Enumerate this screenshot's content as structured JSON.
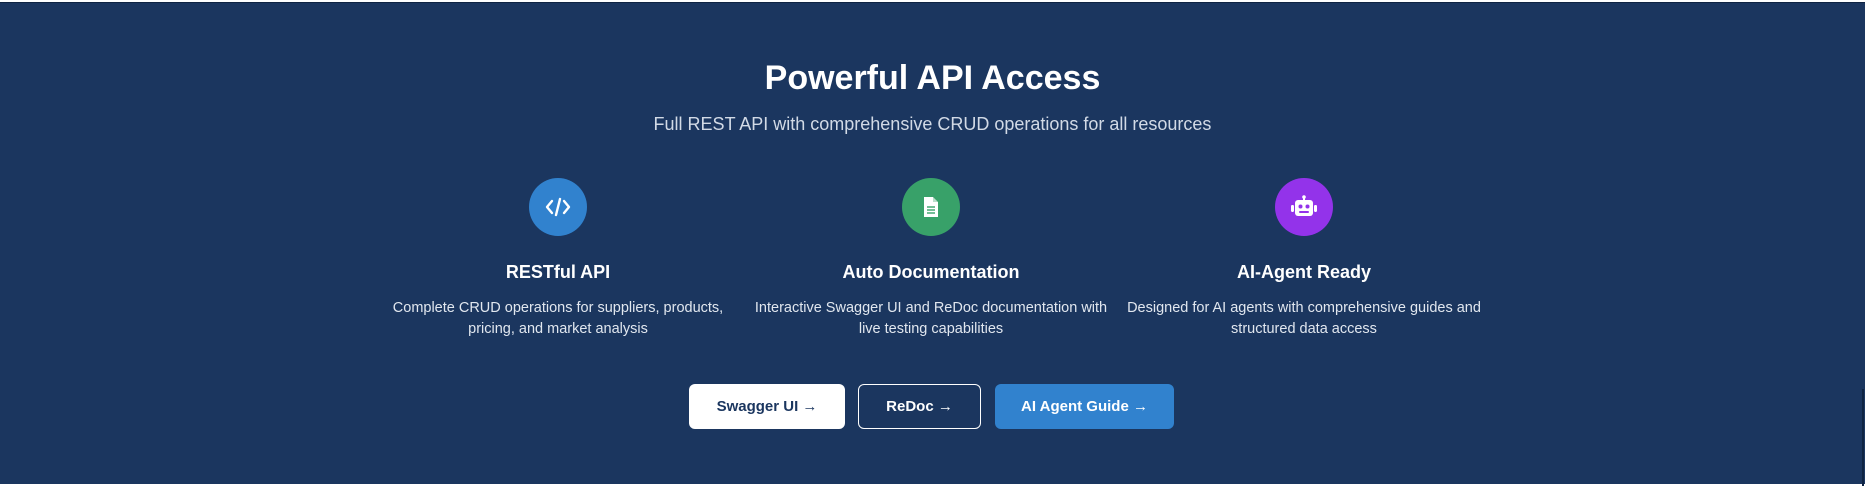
{
  "section": {
    "title": "Powerful API Access",
    "subtitle": "Full REST API with comprehensive CRUD operations for all resources"
  },
  "features": [
    {
      "icon": "code-icon",
      "icon_color": "#3182ce",
      "title": "RESTful API",
      "description": "Complete CRUD operations for suppliers, products, pricing, and market analysis"
    },
    {
      "icon": "document-icon",
      "icon_color": "#38a169",
      "title": "Auto Documentation",
      "description": "Interactive Swagger UI and ReDoc documentation with live testing capabilities"
    },
    {
      "icon": "robot-icon",
      "icon_color": "#9333ea",
      "title": "AI-Agent Ready",
      "description": "Designed for AI agents with comprehensive guides and structured data access"
    }
  ],
  "buttons": {
    "swagger": "Swagger UI →",
    "redoc": "ReDoc →",
    "agent_guide": "AI Agent Guide →"
  },
  "colors": {
    "background": "#1b365f",
    "primary_button": "#3182ce"
  }
}
